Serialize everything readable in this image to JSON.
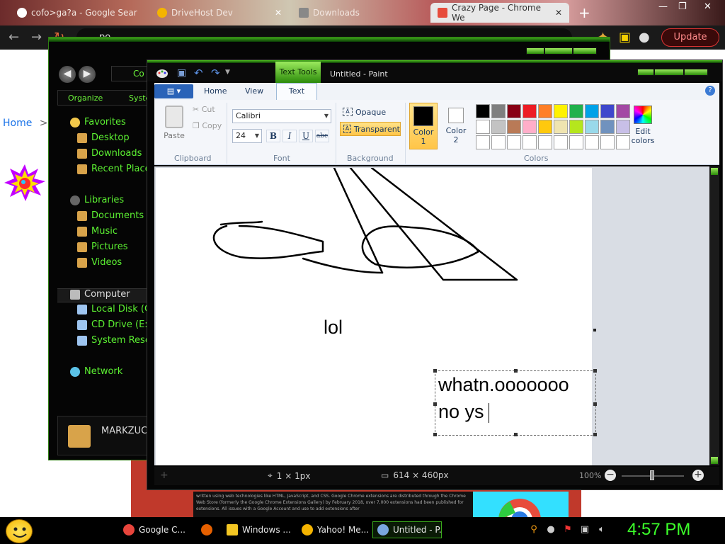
{
  "browser": {
    "tabs": [
      {
        "label": "cofo>ga?a - Google Sear",
        "active": false
      },
      {
        "label": "DriveHost Dev",
        "active": false
      },
      {
        "label": "Downloads",
        "active": false
      },
      {
        "label": "Crazy Page - Chrome We",
        "active": true
      }
    ],
    "new_tab_glyph": "+",
    "omnibox_text": "po",
    "update_label": "Update",
    "page_home_label": "Home",
    "page_home_chevron": ">",
    "wiki_text": "written using web technologies like HTML, JavaScript, and CSS. Google Chrome extensions are distributed through the Chrome Web Store (formerly the Google Chrome Extensions Gallery) by February 2018, over 7,000 extensions had been published for extensions. All issues with a Google Account and use to add extensions after"
  },
  "explorer": {
    "address_text": "Co",
    "organize_label": "Organize",
    "system_label": "Syste",
    "favorites_header": "Favorites",
    "favorites": [
      "Desktop",
      "Downloads",
      "Recent Place"
    ],
    "libraries_header": "Libraries",
    "libraries": [
      "Documents",
      "Music",
      "Pictures",
      "Videos"
    ],
    "computer_header": "Computer",
    "drives": [
      "Local Disk (C",
      "CD Drive (E:)",
      "System Rese"
    ],
    "network_label": "Network",
    "user_label": "MARKZUC"
  },
  "paint": {
    "text_tools_tab": "Text Tools",
    "title": "Untitled - Paint",
    "tabs": {
      "home": "Home",
      "view": "View",
      "text": "Text"
    },
    "help_glyph": "?",
    "clipboard": {
      "paste": "Paste",
      "cut": "Cut",
      "copy": "Copy",
      "group": "Clipboard"
    },
    "font": {
      "family": "Calibri",
      "size": "24",
      "bold": "B",
      "italic": "I",
      "underline": "U",
      "strikethrough": "abc",
      "group": "Font"
    },
    "background": {
      "opaque": "Opaque",
      "transparent": "Transparent",
      "group": "Background"
    },
    "colors": {
      "color1_label": "Color\n1",
      "color1_line1": "Color",
      "color1_line2": "1",
      "color2_line1": "Color",
      "color2_line2": "2",
      "edit_line1": "Edit",
      "edit_line2": "colors",
      "group": "Colors",
      "palette_row1": [
        "#000000",
        "#7f7f7f",
        "#880015",
        "#ed1c24",
        "#ff7f27",
        "#fff200",
        "#22b14c",
        "#00a2e8",
        "#3f48cc",
        "#a349a4"
      ],
      "palette_row2": [
        "#ffffff",
        "#c3c3c3",
        "#b97a57",
        "#ffaec9",
        "#ffc90e",
        "#efe4b0",
        "#b5e61d",
        "#99d9ea",
        "#7092be",
        "#c8bfe7"
      ],
      "palette_row3": [
        "#ffffff",
        "#ffffff",
        "#ffffff",
        "#ffffff",
        "#ffffff",
        "#ffffff",
        "#ffffff",
        "#ffffff",
        "#ffffff",
        "#ffffff"
      ]
    },
    "canvas_text_lol": "lol",
    "textbox_line1": "whatn.ooooooo",
    "textbox_line2": "no ys",
    "status_cursor": "1 × 1px",
    "status_size": "614 × 460px",
    "zoom": "100%"
  },
  "taskbar": {
    "items": [
      {
        "label": "Google C...",
        "icon_color": "#e8453c"
      },
      {
        "label": "",
        "icon_color": "#e66000"
      },
      {
        "label": "Windows ...",
        "icon_color": "#f3c623"
      },
      {
        "label": "Yahoo! Me...",
        "icon_color": "#f5b400"
      },
      {
        "label": "Untitled - P...",
        "icon_color": "#7aa6e0"
      }
    ],
    "clock": "4:57 PM"
  },
  "accent_green": "#5cf032",
  "accent_red": "#d33"
}
